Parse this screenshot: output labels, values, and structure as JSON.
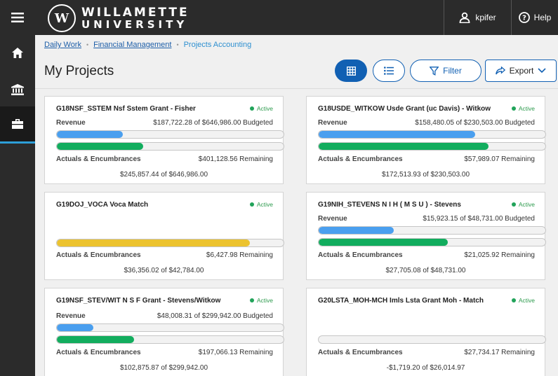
{
  "header": {
    "logo_line1": "WILLAMETTE",
    "logo_line2": "UNIVERSITY",
    "logo_mark": "W",
    "user": "kpifer",
    "help": "Help"
  },
  "nav": {
    "items": [
      {
        "name": "menu",
        "icon": "hamburger-icon"
      },
      {
        "name": "home",
        "icon": "home-icon"
      },
      {
        "name": "institution",
        "icon": "bank-icon"
      },
      {
        "name": "projects",
        "icon": "briefcase-icon",
        "active": true
      }
    ]
  },
  "breadcrumb": {
    "items": [
      "Daily Work",
      "Financial Management"
    ],
    "current": "Projects Accounting"
  },
  "page": {
    "title": "My Projects",
    "filter_label": "Filter",
    "export_label": "Export"
  },
  "labels": {
    "revenue": "Revenue",
    "actuals": "Actuals & Encumbrances"
  },
  "colors": {
    "brand_blue": "#1160b3",
    "revenue_bar": "#4a9fef",
    "actuals_bar": "#12ad5e",
    "warning_bar": "#ecc32f",
    "active": "#21a35a"
  },
  "projects": [
    {
      "title": "G18NSF_SSTEM Nsf Sstem Grant - Fisher",
      "status": "Active",
      "revenue_text": "$187,722.28 of $646,986.00 Budgeted",
      "revenue_pct": 29,
      "actuals_pct": 38,
      "actuals_color": "green",
      "remaining": "$401,128.56 Remaining",
      "summary": "$245,857.44 of $646,986.00"
    },
    {
      "title": "G18USDE_WITKOW Usde Grant (uc Davis) - Witkow",
      "status": "Active",
      "revenue_text": "$158,480.05 of $230,503.00 Budgeted",
      "revenue_pct": 69,
      "actuals_pct": 75,
      "actuals_color": "green",
      "remaining": "$57,989.07 Remaining",
      "summary": "$172,513.93 of $230,503.00"
    },
    {
      "title": "G19DOJ_VOCA Voca Match",
      "status": "Active",
      "revenue_text": "",
      "revenue_pct": null,
      "actuals_pct": 85,
      "actuals_color": "yellow",
      "remaining": "$6,427.98 Remaining",
      "summary": "$36,356.02 of $42,784.00"
    },
    {
      "title": "G19NIH_STEVENS N I H ( M S U ) - Stevens",
      "status": "Active",
      "revenue_text": "$15,923.15 of $48,731.00 Budgeted",
      "revenue_pct": 33,
      "actuals_pct": 57,
      "actuals_color": "green",
      "remaining": "$21,025.92 Remaining",
      "summary": "$27,705.08 of $48,731.00"
    },
    {
      "title": "G19NSF_STEV/WIT N S F Grant - Stevens/Witkow",
      "status": "Active",
      "revenue_text": "$48,008.31 of $299,942.00 Budgeted",
      "revenue_pct": 16,
      "actuals_pct": 34,
      "actuals_color": "green",
      "remaining": "$197,066.13 Remaining",
      "summary": "$102,875.87 of $299,942.00"
    },
    {
      "title": "G20LSTA_MOH-MCH Imls Lsta Grant Moh - Match",
      "status": "Active",
      "revenue_text": "",
      "revenue_pct": null,
      "actuals_pct": 0,
      "actuals_color": "green",
      "remaining": "$27,734.17 Remaining",
      "summary": "-$1,719.20 of $26,014.97"
    }
  ]
}
